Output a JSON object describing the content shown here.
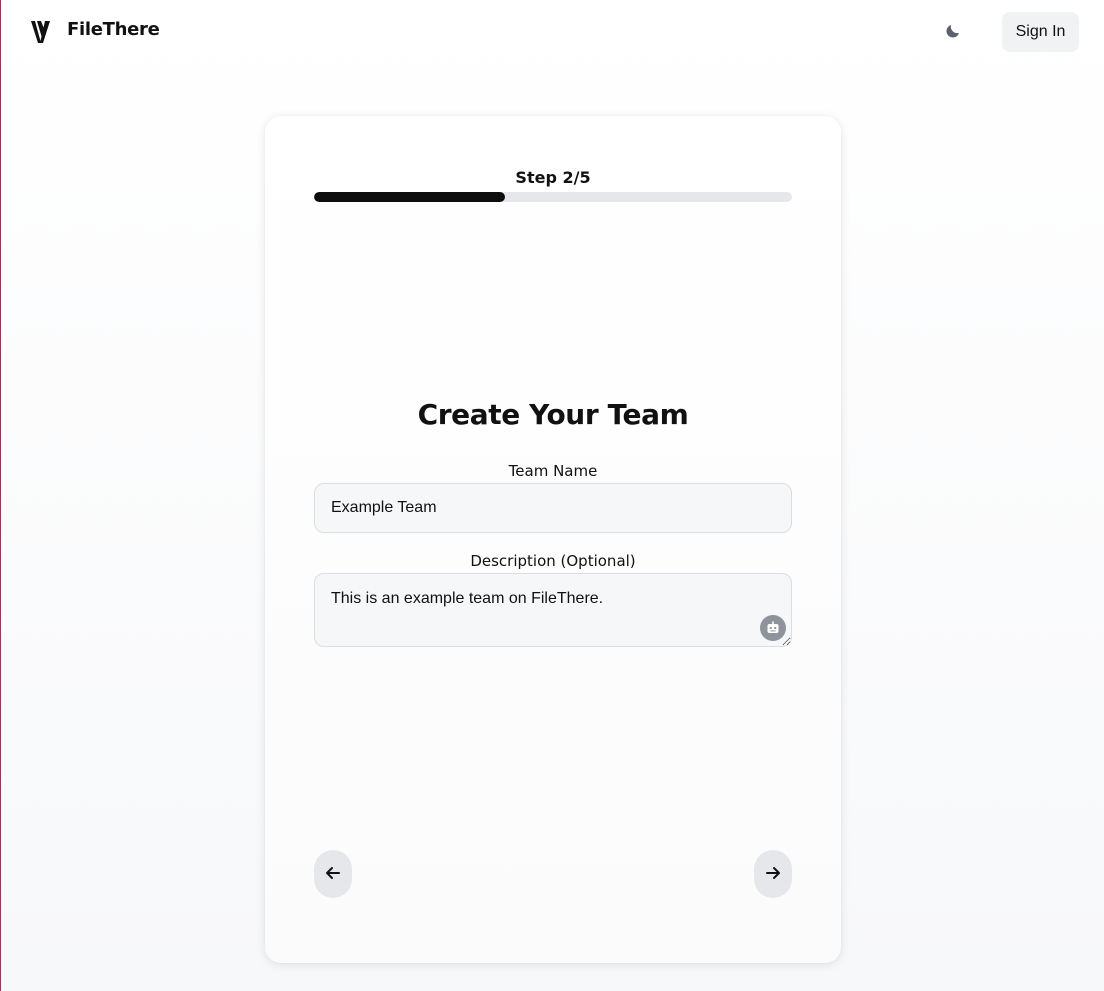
{
  "header": {
    "brand": "FileThere",
    "logo_icon": "filethere-logo-icon",
    "theme_toggle_icon": "moon-icon",
    "signin_label": "Sign In"
  },
  "wizard": {
    "step_label": "Step 2/5",
    "progress_fraction": 0.4,
    "title": "Create Your Team",
    "team_name_label": "Team Name",
    "team_name_value": "Example Team",
    "description_label": "Description (Optional)",
    "description_value": "This is an example team on FileThere.",
    "ai_icon": "robot-icon",
    "back_icon": "arrow-left-icon",
    "next_icon": "arrow-right-icon"
  },
  "colors": {
    "accent": "#0d0d0d",
    "progress_track": "#e6e7ea",
    "input_bg": "#f6f7f9",
    "left_edge": "#d01a5a"
  }
}
